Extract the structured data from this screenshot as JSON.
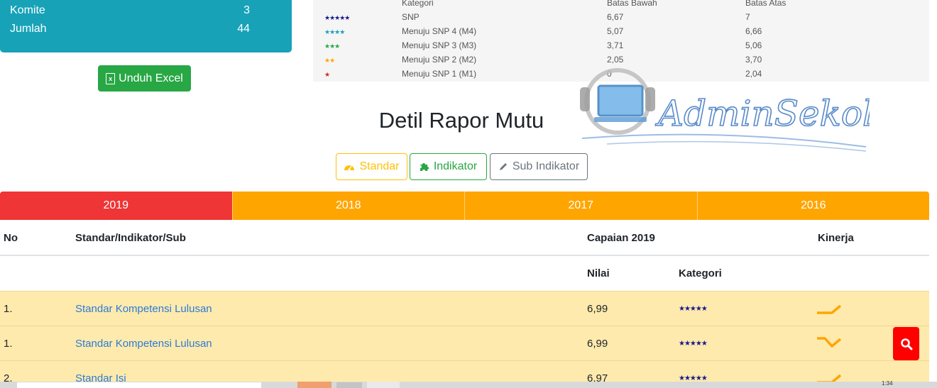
{
  "summary": {
    "rows": [
      {
        "label": "Komite",
        "value": "3"
      },
      {
        "label": "Jumlah",
        "value": "44"
      }
    ],
    "export_label": "Unduh Excel"
  },
  "legend": {
    "headers": {
      "kategori": "Kategori",
      "bawah": "Batas Bawah",
      "atas": "Batas Atas"
    },
    "rows": [
      {
        "stars": "★★★★★",
        "color": "#1a1a8c",
        "kategori": "SNP",
        "bawah": "6,67",
        "atas": "7"
      },
      {
        "stars": "★★★★",
        "color": "#17a2b8",
        "kategori": "Menuju SNP 4 (M4)",
        "bawah": "5,07",
        "atas": "6,66"
      },
      {
        "stars": "★★★",
        "color": "#28a745",
        "kategori": "Menuju SNP 3 (M3)",
        "bawah": "3,71",
        "atas": "5,06"
      },
      {
        "stars": "★★",
        "color": "#ffa500",
        "kategori": "Menuju SNP 2 (M2)",
        "bawah": "2,05",
        "atas": "3,70"
      },
      {
        "stars": "★",
        "color": "#e02020",
        "kategori": "Menuju SNP 1 (M1)",
        "bawah": "0",
        "atas": "2,04"
      }
    ]
  },
  "watermark": {
    "text": "AdminSekolah.Com"
  },
  "page_title": "Detil Rapor Mutu",
  "view_tabs": {
    "standar": "Standar",
    "indikator": "Indikator",
    "sub": "Sub Indikator"
  },
  "year_tabs": [
    "2019",
    "2018",
    "2017",
    "2016"
  ],
  "table": {
    "headers": {
      "no": "No",
      "name": "Standar/Indikator/Sub",
      "capaian": "Capaian 2019",
      "kinerja": "Kinerja",
      "nilai": "Nilai",
      "kategori": "Kategori"
    },
    "rows": [
      {
        "no": "1.",
        "name": "Standar Kompetensi Lulusan",
        "nilai": "6,99",
        "kategori": "★★★★★",
        "trend": "up"
      },
      {
        "no": "1.",
        "name": "Standar Kompetensi Lulusan",
        "nilai": "6,99",
        "kategori": "★★★★★",
        "trend": "v"
      },
      {
        "no": "2.",
        "name": "Standar Isi",
        "nilai": "6,97",
        "kategori": "★★★★★",
        "trend": "up"
      }
    ]
  },
  "taskbar": {
    "clock": "1:34"
  },
  "colors": {
    "accent_teal": "#17a2b8",
    "success": "#28a745",
    "warning": "#ffc107",
    "active_year": "#ef3535",
    "year": "#ffa500",
    "row_bg": "#ffeaad",
    "link": "#2a7bd6",
    "danger": "#ff0000"
  }
}
